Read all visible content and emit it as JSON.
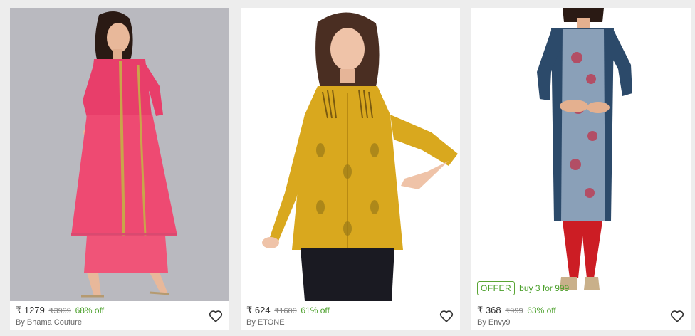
{
  "products": [
    {
      "currency": "₹",
      "price": "1279",
      "mrp": "₹3999",
      "discount": "68% off",
      "brand": "By Bhama Couture",
      "image": "pink-kurta-palazzo-model",
      "bg_color": "#b9b9bf"
    },
    {
      "currency": "₹",
      "price": "624",
      "mrp": "₹1600",
      "discount": "61% off",
      "brand": "By ETONE",
      "image": "mustard-printed-top-model",
      "bg_color": "#ffffff"
    },
    {
      "currency": "₹",
      "price": "368",
      "mrp": "₹999",
      "discount": "63% off",
      "brand": "By Envy9",
      "image": "blue-printed-kurta-model",
      "bg_color": "#ffffff",
      "offer_badge": "OFFER",
      "offer_text": "buy 3 for 999"
    }
  ],
  "icons": {
    "wishlist": "heart-outline-icon"
  },
  "colors": {
    "discount": "#4a9f2a",
    "page_bg": "#ededed"
  }
}
